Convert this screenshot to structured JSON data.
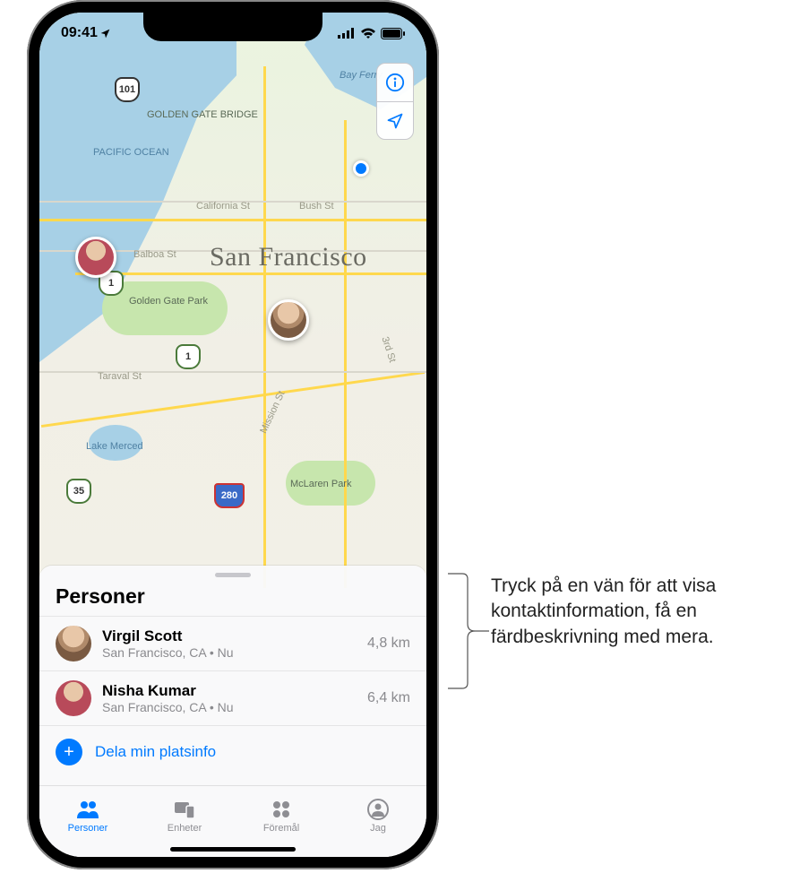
{
  "status": {
    "time": "09:41",
    "loc_icon": "location-arrow"
  },
  "map": {
    "city": "San Francisco",
    "labels": {
      "pacific_ocean": "PACIFIC OCEAN",
      "golden_gate_bridge": "GOLDEN GATE BRIDGE",
      "golden_gate_park": "Golden Gate Park",
      "lake_merced": "Lake Merced",
      "mclaren_park": "McLaren Park",
      "california_st": "California St",
      "bush_st": "Bush St",
      "balboa_st": "Balboa St",
      "taraval_st": "Taraval St",
      "mission_st": "Mission St",
      "third_st": "3rd St",
      "bay_ferry": "Bay Ferry"
    },
    "shields": {
      "us101": "101",
      "ca1_a": "1",
      "ca1_b": "1",
      "ca35": "35",
      "i280": "280"
    }
  },
  "sheet": {
    "title": "Personer",
    "people": [
      {
        "name": "Virgil Scott",
        "sub": "San Francisco, CA • Nu",
        "dist": "4,8 km"
      },
      {
        "name": "Nisha Kumar",
        "sub": "San Francisco, CA • Nu",
        "dist": "6,4 km"
      }
    ],
    "share_label": "Dela min platsinfo"
  },
  "tabs": [
    {
      "label": "Personer"
    },
    {
      "label": "Enheter"
    },
    {
      "label": "Föremål"
    },
    {
      "label": "Jag"
    }
  ],
  "callout": "Tryck på en vän för att visa kontaktinformation, få en färdbeskrivning med mera."
}
